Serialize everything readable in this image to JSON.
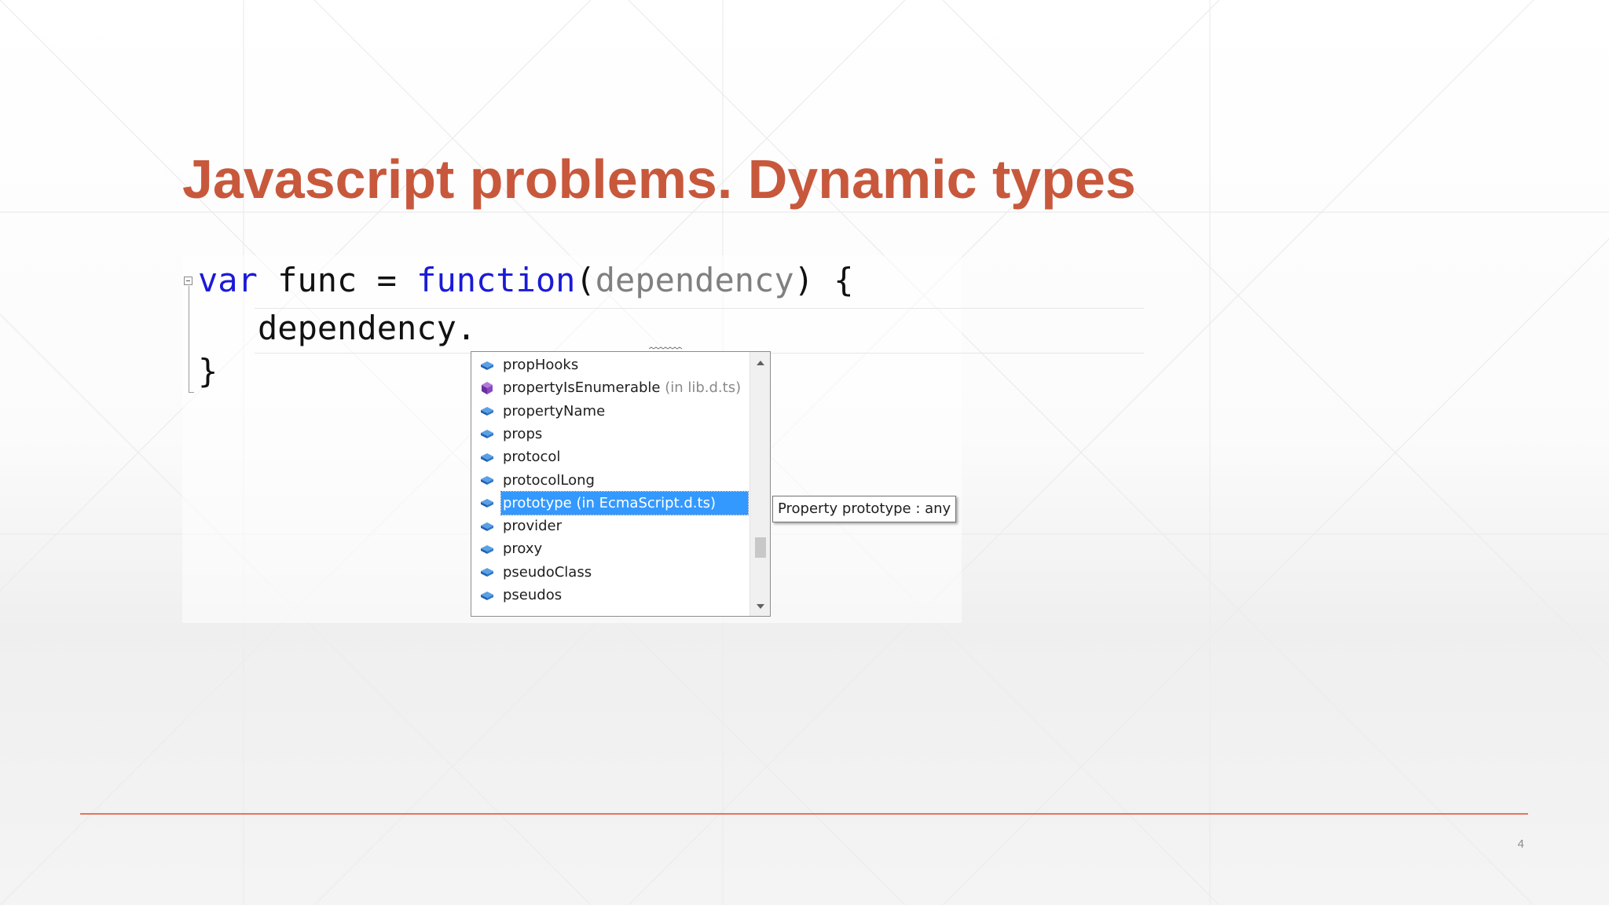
{
  "slide": {
    "title": "Javascript problems. Dynamic types",
    "page_number": "4",
    "colors": {
      "title": "#c8583c",
      "footer_rule": "#e8735a",
      "keyword": "#1a1ad6",
      "parameter": "#808080",
      "selection": "#3399ff"
    }
  },
  "editor": {
    "line1": {
      "kw_var": "var",
      "func_name": " func = ",
      "kw_function": "function",
      "open_paren": "(",
      "param": "dependency",
      "close": ") {"
    },
    "line2": "dependency.",
    "line3": "}"
  },
  "completion": {
    "items": [
      {
        "label": "propHooks",
        "hint": "",
        "icon": "field-icon"
      },
      {
        "label": "propertyIsEnumerable",
        "hint": " (in lib.d.ts)",
        "icon": "method-icon"
      },
      {
        "label": "propertyName",
        "hint": "",
        "icon": "field-icon"
      },
      {
        "label": "props",
        "hint": "",
        "icon": "field-icon"
      },
      {
        "label": "protocol",
        "hint": "",
        "icon": "field-icon"
      },
      {
        "label": "protocolLong",
        "hint": "",
        "icon": "field-icon"
      },
      {
        "label": "prototype",
        "hint": " (in EcmaScript.d.ts)",
        "icon": "field-icon",
        "selected": true
      },
      {
        "label": "provider",
        "hint": "",
        "icon": "field-icon"
      },
      {
        "label": "proxy",
        "hint": "",
        "icon": "field-icon"
      },
      {
        "label": "pseudoClass",
        "hint": "",
        "icon": "field-icon"
      },
      {
        "label": "pseudos",
        "hint": "",
        "icon": "field-icon"
      }
    ],
    "tooltip": "Property prototype : any"
  }
}
